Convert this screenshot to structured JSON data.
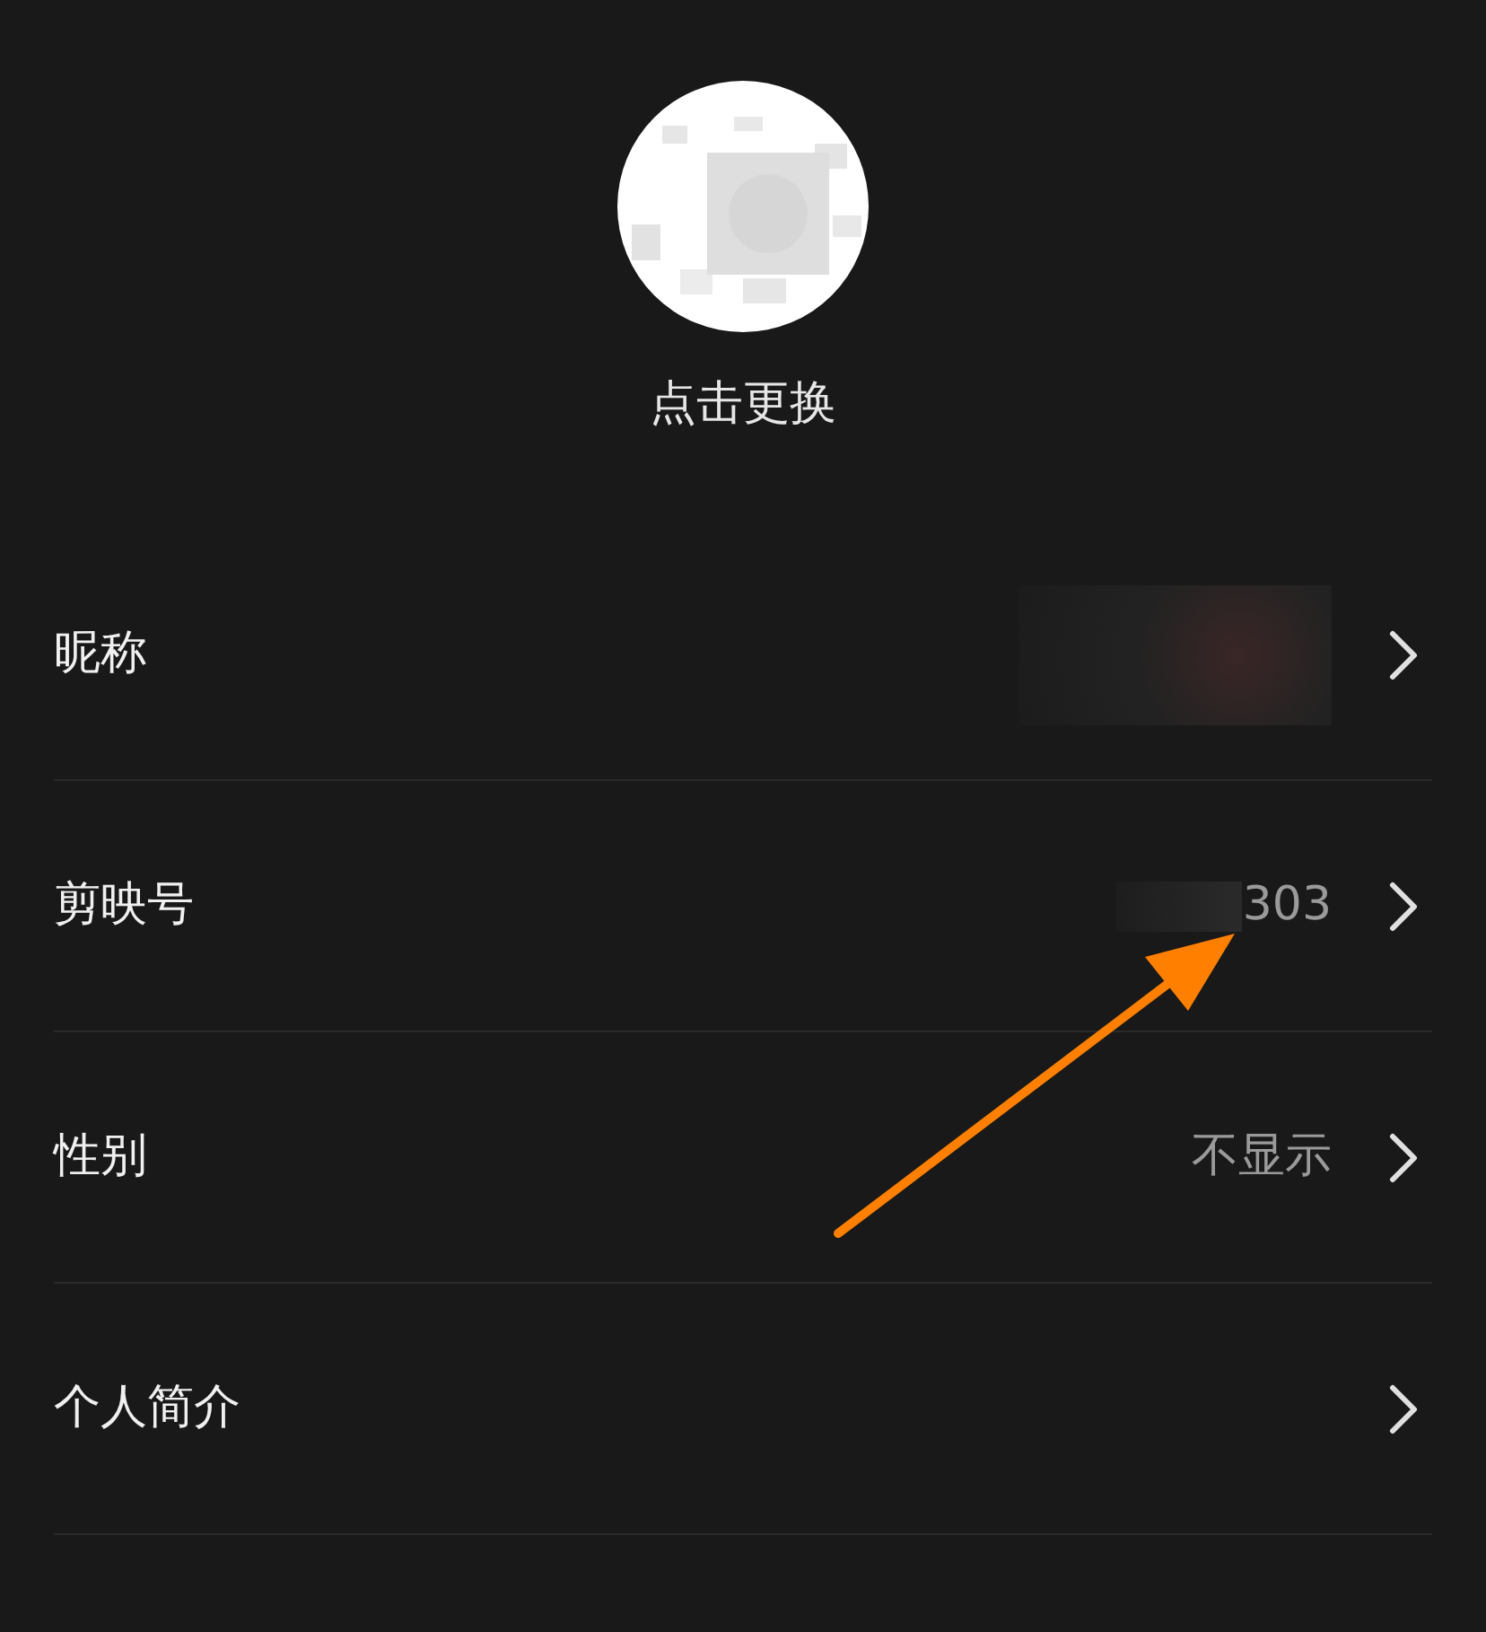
{
  "avatar": {
    "kind": "picture",
    "caption": "点击更换"
  },
  "rows": [
    {
      "label": "昵称",
      "redacted": true
    },
    {
      "label": "剪映号",
      "redacted": true,
      "value": "303"
    },
    {
      "label": "性别",
      "value": "不显示"
    },
    {
      "label": "个人简介"
    }
  ],
  "annotation": {
    "kind": "arrow"
  }
}
